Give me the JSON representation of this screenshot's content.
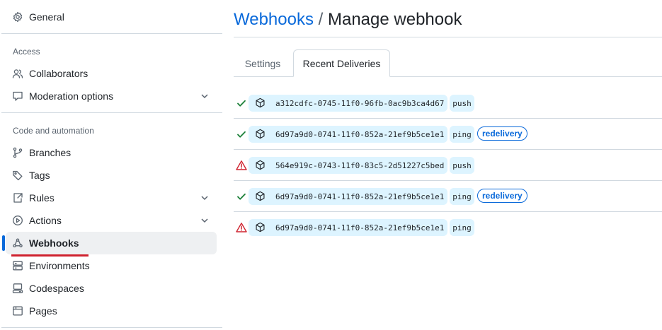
{
  "sidebar": {
    "general": "General",
    "access_heading": "Access",
    "collaborators": "Collaborators",
    "moderation": "Moderation options",
    "code_heading": "Code and automation",
    "branches": "Branches",
    "tags": "Tags",
    "rules": "Rules",
    "actions": "Actions",
    "webhooks": "Webhooks",
    "environments": "Environments",
    "codespaces": "Codespaces",
    "pages": "Pages"
  },
  "header": {
    "crumb": "Webhooks",
    "separator": "/",
    "title": "Manage webhook"
  },
  "tabs": {
    "settings": "Settings",
    "recent": "Recent Deliveries"
  },
  "deliveries": [
    {
      "status": "success",
      "guid": "a312cdfc-0745-11f0-96fb-0ac9b3ca4d67",
      "event": "push",
      "redelivery": ""
    },
    {
      "status": "success",
      "guid": "6d97a9d0-0741-11f0-852a-21ef9b5ce1e1",
      "event": "ping",
      "redelivery": "redelivery"
    },
    {
      "status": "failure",
      "guid": "564e919c-0743-11f0-83c5-2d51227c5bed",
      "event": "push",
      "redelivery": ""
    },
    {
      "status": "success",
      "guid": "6d97a9d0-0741-11f0-852a-21ef9b5ce1e1",
      "event": "ping",
      "redelivery": "redelivery"
    },
    {
      "status": "failure",
      "guid": "6d97a9d0-0741-11f0-852a-21ef9b5ce1e1",
      "event": "ping",
      "redelivery": ""
    }
  ],
  "colors": {
    "accent": "#0969da",
    "success": "#1a7f37",
    "danger": "#cf222e",
    "chip_bg": "#ddf4ff"
  }
}
